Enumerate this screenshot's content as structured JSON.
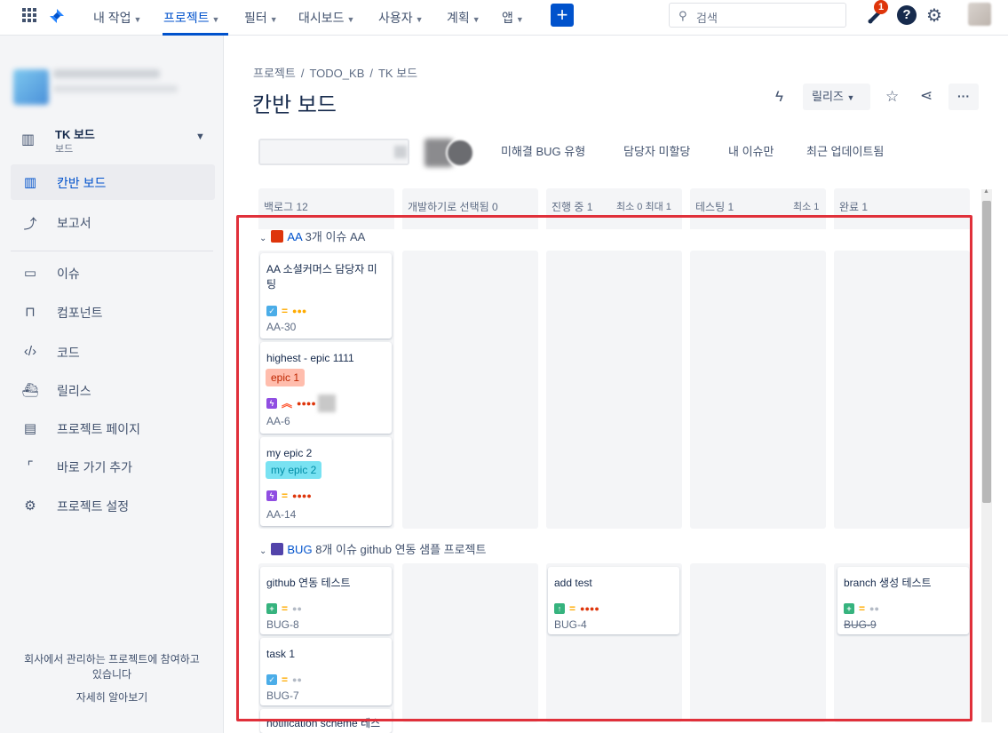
{
  "topnav": {
    "items": [
      {
        "label": "내 작업",
        "active": false
      },
      {
        "label": "프로젝트",
        "active": true
      },
      {
        "label": "필터",
        "active": false
      },
      {
        "label": "대시보드",
        "active": false
      },
      {
        "label": "사용자",
        "active": false
      },
      {
        "label": "계획",
        "active": false
      },
      {
        "label": "앱",
        "active": false
      }
    ],
    "create_label": "+",
    "search_placeholder": "검색",
    "notification_count": "1",
    "help_label": "?"
  },
  "sidebar": {
    "board_name": "TK 보드",
    "board_type": "보드",
    "items": [
      {
        "label": "칸반 보드",
        "icon": "board-icon",
        "selected": true
      },
      {
        "label": "보고서",
        "icon": "chart-icon",
        "selected": false
      },
      {
        "label": "이슈",
        "icon": "issues-icon",
        "selected": false
      },
      {
        "label": "컴포넌트",
        "icon": "components-icon",
        "selected": false
      },
      {
        "label": "코드",
        "icon": "code-icon",
        "selected": false
      },
      {
        "label": "릴리스",
        "icon": "ship-icon",
        "selected": false
      },
      {
        "label": "프로젝트 페이지",
        "icon": "page-icon",
        "selected": false
      },
      {
        "label": "바로 가기 추가",
        "icon": "add-shortcut-icon",
        "selected": false
      },
      {
        "label": "프로젝트 설정",
        "icon": "gear-icon",
        "selected": false
      }
    ],
    "footer_text_line1": "회사에서 관리하는 프로젝트에 참여하고",
    "footer_text_line2": "있습니다",
    "footer_link": "자세히 알아보기"
  },
  "main": {
    "breadcrumb": [
      "프로젝트",
      "TODO_KB",
      "TK 보드"
    ],
    "breadcrumb_sep": "/",
    "title": "칸반 보드",
    "release_label": "릴리즈",
    "filters": [
      "미해결 BUG 유형",
      "담당자 미할당",
      "내 이슈만",
      "최근 업데이트됨"
    ]
  },
  "columns": [
    {
      "name": "백로그 12",
      "limit": ""
    },
    {
      "name": "개발하기로 선택됨 0",
      "limit": ""
    },
    {
      "name": "진행 중 1",
      "limit": "최소 0 최대 1"
    },
    {
      "name": "테스팅 1",
      "limit": "최소 1"
    },
    {
      "name": "완료 1",
      "limit": ""
    }
  ],
  "swimlanes": [
    {
      "key": "AA",
      "count_text": "3개 이슈",
      "name": "AA",
      "color": "#de350b"
    },
    {
      "key": "BUG",
      "count_text": "8개 이슈",
      "name": "github 연동 샘플 프로젝트",
      "color": "#5243aa"
    }
  ],
  "cards": {
    "aa30": {
      "summary": "AA 소셜커머스 담당자 미팅",
      "key": "AA-30",
      "type": "task",
      "priority": "medium"
    },
    "aa6": {
      "summary": "highest - epic 1111",
      "epic": "epic 1",
      "key": "AA-6",
      "type": "epic",
      "priority": "highest"
    },
    "aa14": {
      "summary": "my epic 2",
      "epic": "my epic 2",
      "key": "AA-14",
      "type": "epic",
      "priority": "medium"
    },
    "bug8": {
      "summary": "github 연동 테스트",
      "key": "BUG-8",
      "type": "story",
      "priority": "medium"
    },
    "bug7": {
      "summary": "task 1",
      "key": "BUG-7",
      "type": "task",
      "priority": "medium"
    },
    "bug_partial": {
      "summary": "notification scheme 테스"
    },
    "bug4": {
      "summary": "add test",
      "key": "BUG-4",
      "type": "improvement",
      "priority": "medium"
    },
    "bug9": {
      "summary": "branch 생성 테스트",
      "key": "BUG-9",
      "type": "story",
      "priority": "medium"
    }
  },
  "colors": {
    "accent": "#0052cc",
    "highlight_outline": "#e0303a",
    "epic1_bg": "#ffbdad",
    "epic2_bg": "#79e2f2"
  }
}
